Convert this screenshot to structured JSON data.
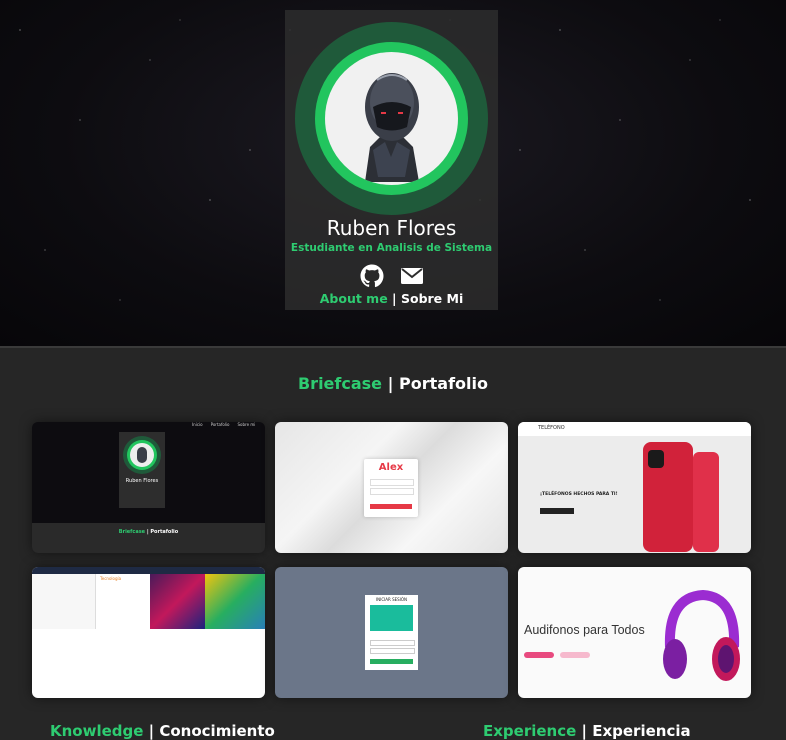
{
  "profile": {
    "name": "Ruben Flores",
    "subtitle": "Estudiante en Analisis de Sistema",
    "about_en": "About me",
    "separator": "|",
    "about_es": "Sobre Mi"
  },
  "icons": {
    "github": "github-icon",
    "email": "email-icon"
  },
  "section": {
    "title_en": "Briefcase",
    "separator": "|",
    "title_es": "Portafolio"
  },
  "projects": [
    {
      "nav": [
        "Inicio",
        "Portafolio",
        "Sobre mi"
      ],
      "name": "Ruben Flores",
      "footer_en": "Briefcase",
      "footer_es": "Portafolio"
    },
    {
      "brand": "Alex"
    },
    {
      "brand": "TELÉFONO",
      "headline": "¡TELÉFONOS HECHOS PARA TI!"
    },
    {
      "label": "Tecnología"
    },
    {
      "label": "INICIAR SESIÓN"
    },
    {
      "headline": "Audifonos para Todos"
    }
  ],
  "colors": {
    "accent": "#2ecc71",
    "background": "#262626"
  }
}
